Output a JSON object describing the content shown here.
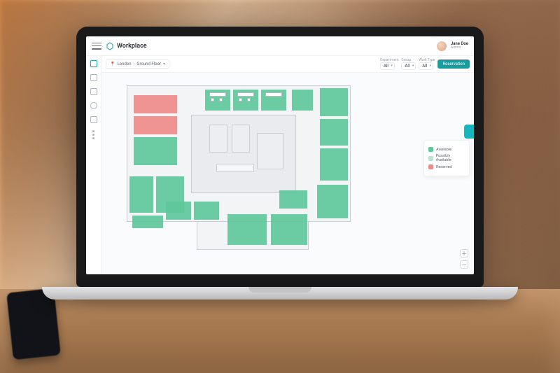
{
  "brand": "Workplace",
  "user": {
    "name": "Jane Doe",
    "role": "Admin"
  },
  "breadcrumb": {
    "location": "London",
    "floor": "Ground Floor"
  },
  "filters": {
    "department": {
      "label": "Department",
      "value": "All"
    },
    "group": {
      "label": "Group",
      "value": "All"
    },
    "worktype": {
      "label": "Work Type",
      "value": "All"
    }
  },
  "actions": {
    "reservation": "Reservation"
  },
  "legend": {
    "available": "Available",
    "possibly": "Possibly Available",
    "reserved": "Reserved"
  },
  "colors": {
    "available": "#5fc79a",
    "possibly": "#b8e5d1",
    "reserved": "#ef8a8a",
    "accent": "#17b6bd"
  }
}
